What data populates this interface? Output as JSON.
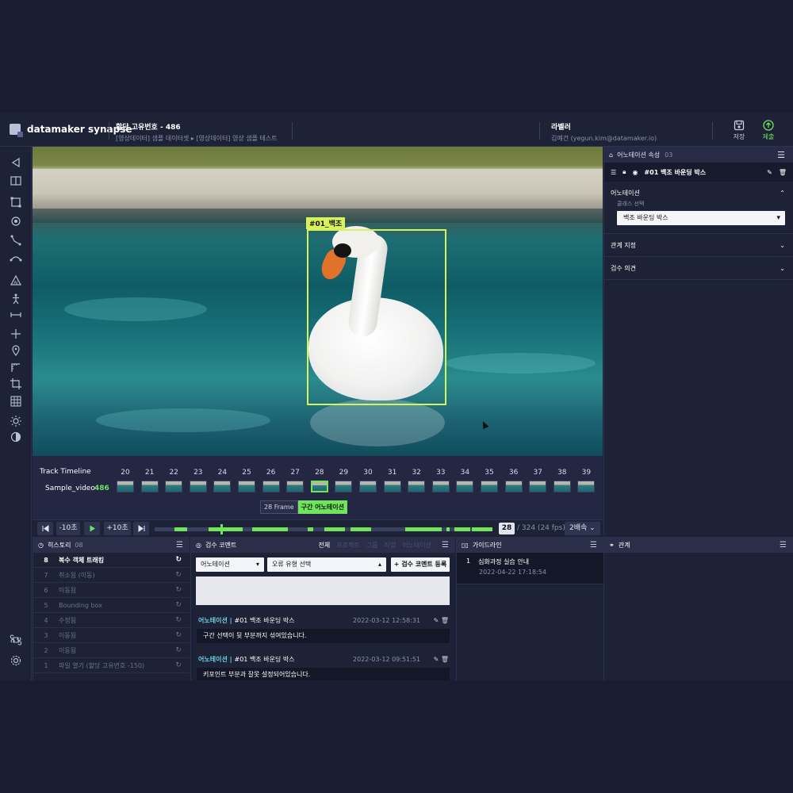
{
  "header": {
    "logo": "datamaker synapse",
    "assignment_title": "할당 고유번호 - 486",
    "breadcrumb": "[영상데이터] 샘플 데이터셋 ▸ [영상데이터] 영상 샘플 테스트",
    "labeler_title": "라벨러",
    "labeler_user": "김예건 (yegun.kim@datamaker.io)",
    "save_label": "저장",
    "submit_label": "제출"
  },
  "canvas": {
    "bbox_label": "#01_백조"
  },
  "timeline": {
    "title": "Track Timeline",
    "sample_name": "Sample_video",
    "sample_count": "486",
    "frames": [
      "20",
      "21",
      "22",
      "23",
      "24",
      "25",
      "26",
      "27",
      "28",
      "29",
      "30",
      "31",
      "32",
      "33",
      "34",
      "35",
      "36",
      "37",
      "38",
      "39"
    ],
    "active_frame": "28",
    "tip_frame": "28 Frame",
    "tip_action": "구간 어노테이션"
  },
  "transport": {
    "back10": "-10초",
    "fwd10": "+10초",
    "current": "28",
    "total": "/ 324 (24 fps)",
    "speed": "2배속"
  },
  "annotation_panel": {
    "title": "어노테이션 속성",
    "count": "03",
    "item_name": "#01 백조 바운딩 박스",
    "section_annotation": "어노테이션",
    "class_label": "클래스 선택",
    "class_value": "백조 바운딩 박스",
    "section_relation": "관계 지정",
    "section_review": "검수 의견"
  },
  "history": {
    "title": "히스토리",
    "count": "08",
    "rows": [
      {
        "n": "8",
        "label": "복수 객체 트래킹"
      },
      {
        "n": "7",
        "label": "취소됨 (이동)"
      },
      {
        "n": "6",
        "label": "이동됨"
      },
      {
        "n": "5",
        "label": "Bounding box"
      },
      {
        "n": "4",
        "label": "수정됨"
      },
      {
        "n": "3",
        "label": "이동됨"
      },
      {
        "n": "2",
        "label": "이동됨"
      },
      {
        "n": "1",
        "label": "파일 열기 (할당 고유번호 -150)"
      }
    ]
  },
  "review": {
    "title": "검수 코멘트",
    "filters": [
      "전체",
      "프로젝트",
      "그룹",
      "작업",
      "어노테이션"
    ],
    "select_type": "어노테이션",
    "select_error": "오류 유형 선택",
    "add_button": "+ 검수 코멘트 등록",
    "comments": [
      {
        "tag": "어노테이션 |",
        "name": "#01 백조 바운딩 박스",
        "time": "2022-03-12 12:58:31",
        "body": "구간 선택이 뒷 부분까지 섞여있습니다."
      },
      {
        "tag": "어노테이션 |",
        "name": "#01 백조 바운딩 박스",
        "time": "2022-03-12 09:51:51",
        "body": "키포인트 부분과 잘못 설정되어있습니다."
      }
    ]
  },
  "guide": {
    "title": "가이드라인",
    "n": "1",
    "label": "심화과정 실습 안내",
    "date": "2022-04-22 17:18:54"
  },
  "relation": {
    "title": "관계"
  },
  "colors": {
    "accent": "#6fe45c",
    "bbox": "#d8f35a",
    "panel_bg": "#1e2237"
  }
}
